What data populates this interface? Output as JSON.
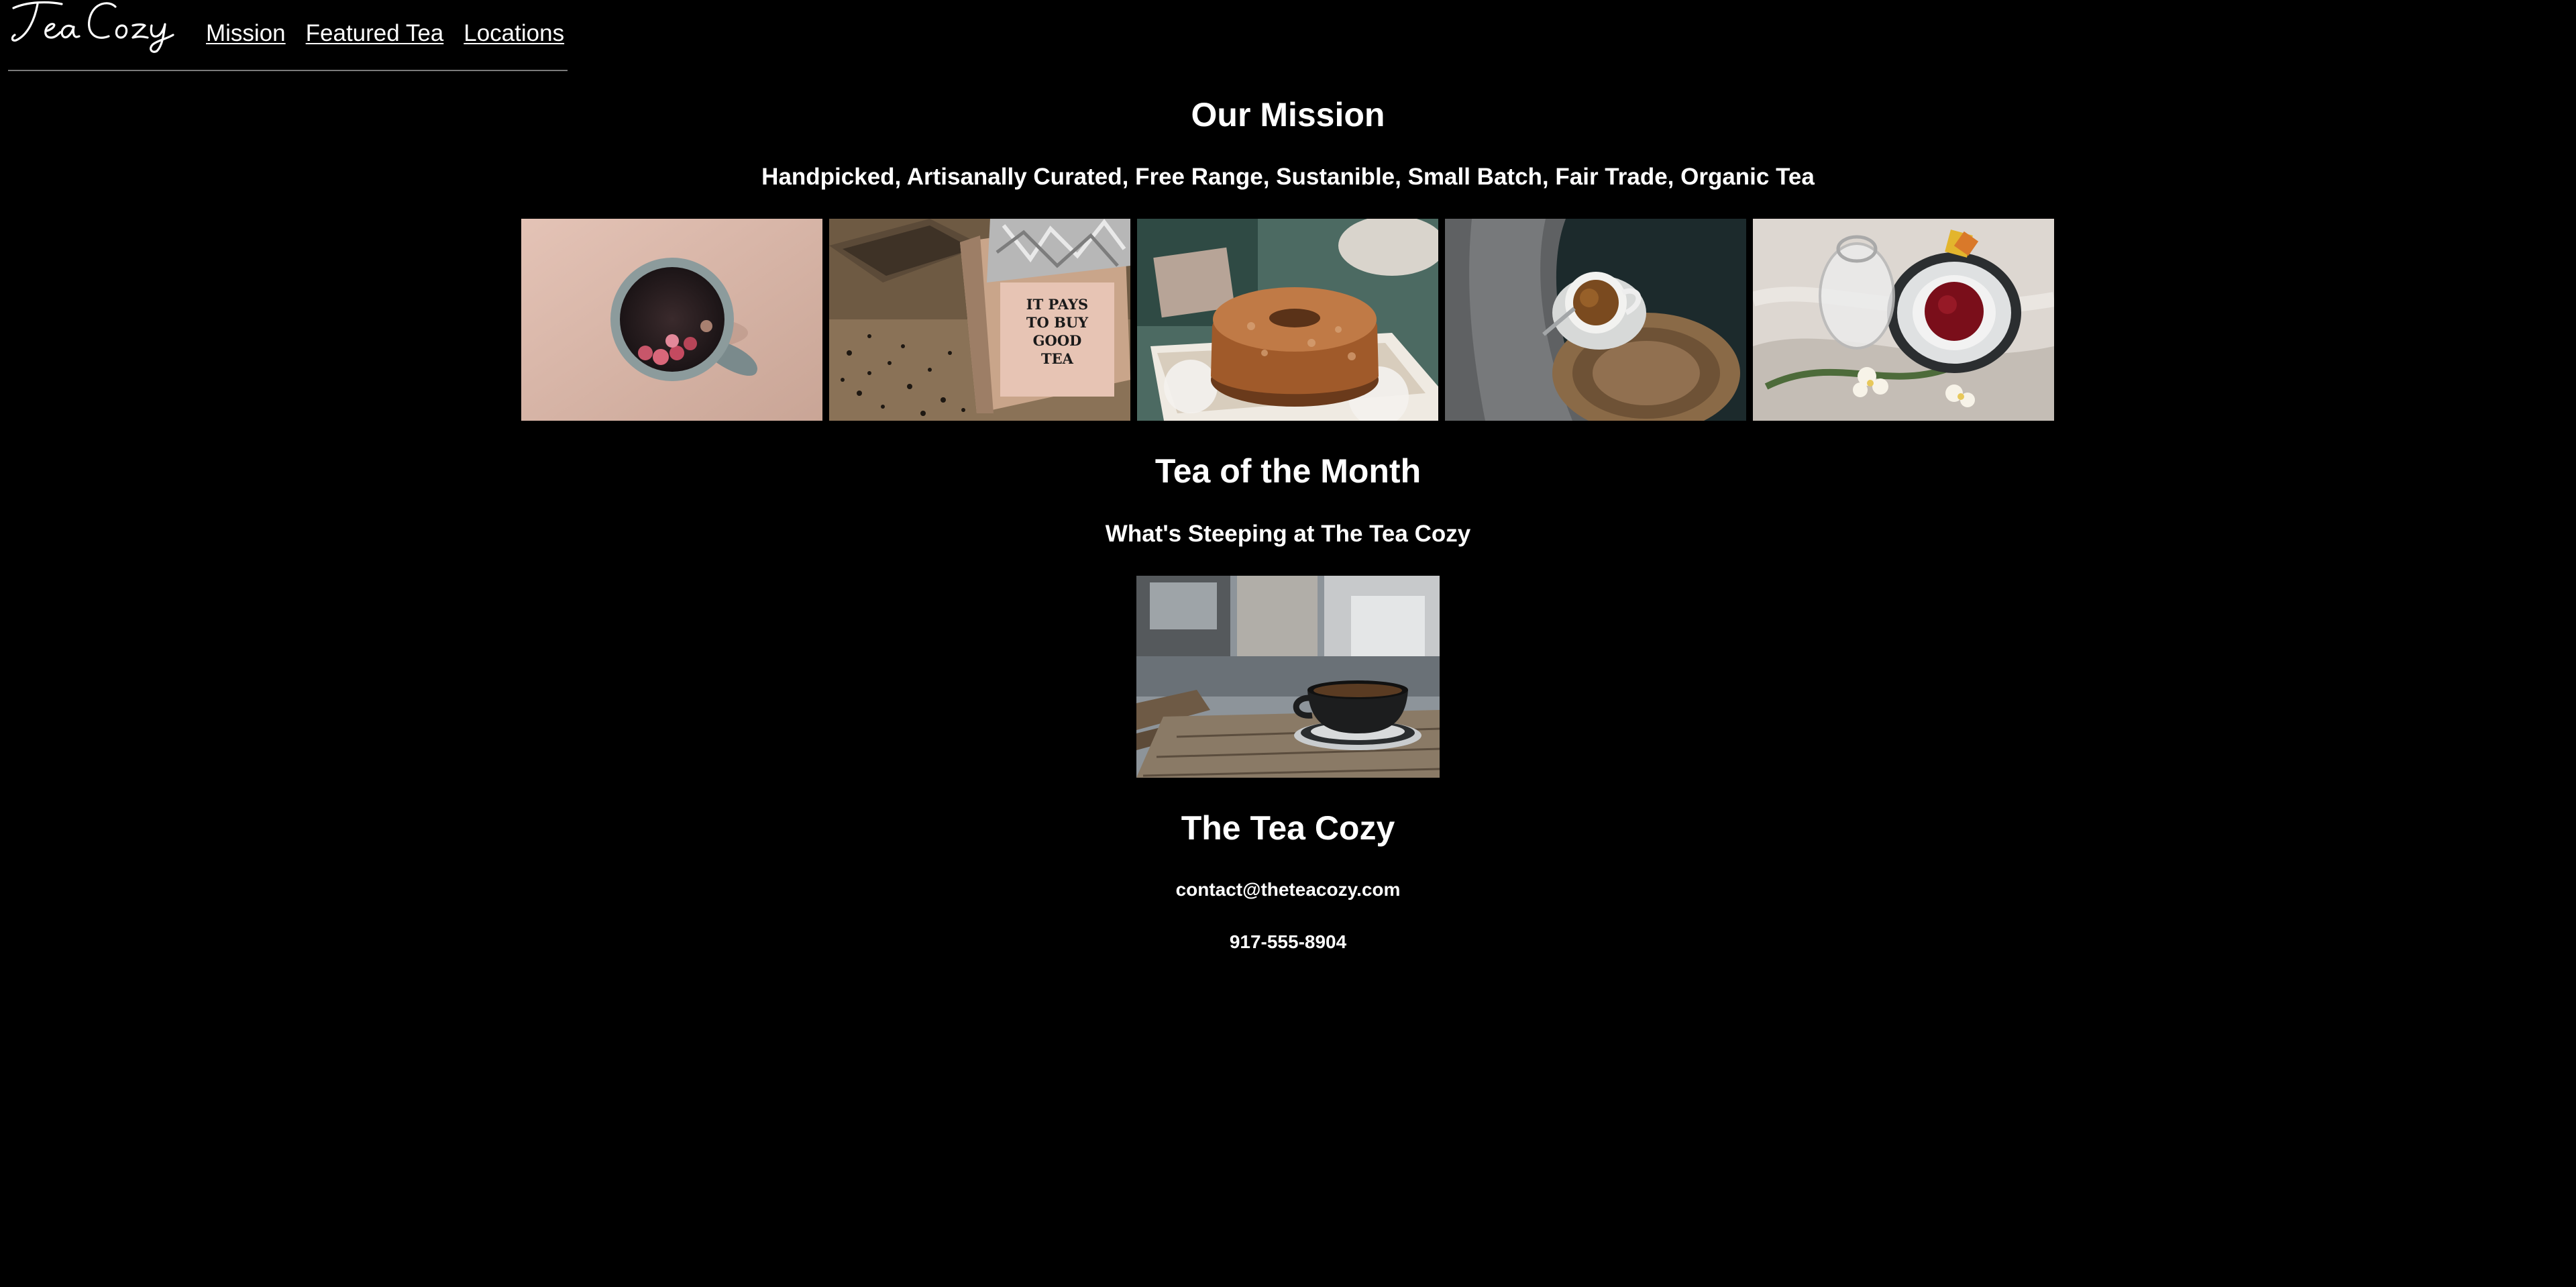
{
  "header": {
    "logo_text": "Tea Cozy",
    "nav": [
      {
        "label": "Mission"
      },
      {
        "label": "Featured Tea"
      },
      {
        "label": "Locations"
      }
    ]
  },
  "mission": {
    "title": "Our Mission",
    "subtitle": "Handpicked, Artisanally Curated, Free Range, Sustanible, Small Batch, Fair Trade, Organic Tea",
    "photos": [
      {
        "icon": "tea-mug-with-berries-photo"
      },
      {
        "icon": "tea-box-sign-photo",
        "sign_text": "IT PAYS TO BUY GOOD TEA"
      },
      {
        "icon": "bundt-cake-photo"
      },
      {
        "icon": "teacup-on-tray-photo"
      },
      {
        "icon": "tea-with-teapot-photo"
      }
    ]
  },
  "featured": {
    "title": "Tea of the Month",
    "subtitle": "What's Steeping at The Tea Cozy",
    "photo": {
      "icon": "coffee-cup-on-table-photo"
    }
  },
  "footer": {
    "title": "The Tea Cozy",
    "email": "contact@theteacozy.com",
    "phone": "917-555-8904"
  },
  "colors": {
    "background": "#000000",
    "text": "#ffffff",
    "divider": "#7a7a7a"
  }
}
